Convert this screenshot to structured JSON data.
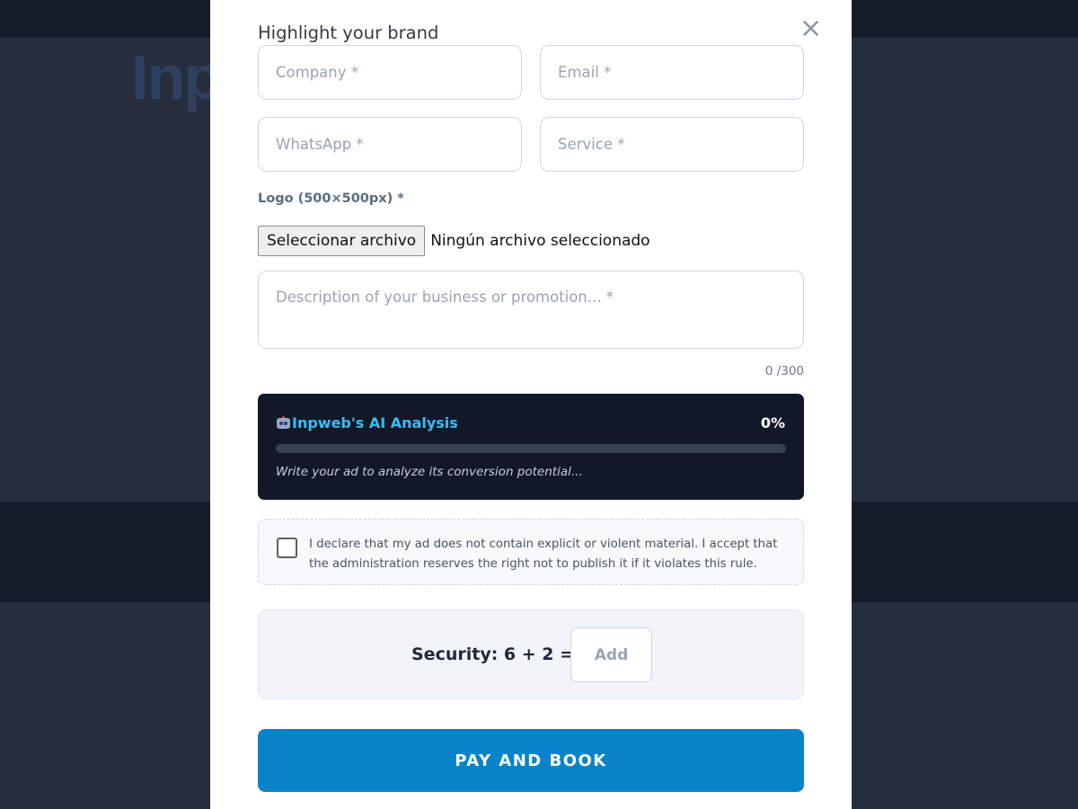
{
  "background": {
    "logo_text": "Inp"
  },
  "modal": {
    "title": "Highlight your brand",
    "close_icon": "×"
  },
  "form": {
    "company_placeholder": "Company *",
    "email_placeholder": "Email *",
    "whatsapp_placeholder": "WhatsApp *",
    "service_placeholder": "Service *",
    "logo_label": "Logo (500×500px) *",
    "file_button_label": "Seleccionar archivo",
    "file_status": "Ningún archivo seleccionado",
    "description_placeholder": "Description of your business or promotion... *",
    "char_count": "0 /300"
  },
  "ai_analysis": {
    "icon": "robot-icon",
    "title": "Inpweb's AI Analysis",
    "percent_label": "0%",
    "progress": 0,
    "hint": "Write your ad to analyze its conversion potential..."
  },
  "declaration": {
    "checked": false,
    "text": "I declare that my ad does not contain explicit or violent material. I accept that the administration reserves the right not to publish it if it violates this rule."
  },
  "security": {
    "label": "Security: 6 + 2 =",
    "input_placeholder": "Add"
  },
  "submit": {
    "label": "PAY AND BOOK"
  },
  "colors": {
    "accent": "#0784c9",
    "ai_panel_bg": "#111827",
    "ai_title": "#38bdf8",
    "overlay_bg": "#262d3d"
  }
}
